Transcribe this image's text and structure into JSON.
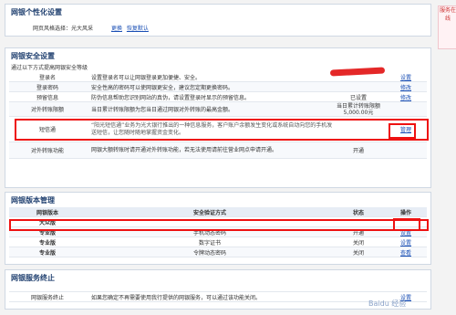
{
  "personalize": {
    "title": "网银个性化设置",
    "style_label": "网页风格选择：光大风采",
    "change_link": "更换",
    "restore_link": "恢复默认"
  },
  "security": {
    "title": "网银安全设置",
    "subtitle": "通过以下方式提高网银安全等级",
    "rows": [
      {
        "name": "登录名",
        "desc": "设置登录名可以让网银登录更加便捷、安全。",
        "status": "",
        "action": "设置"
      },
      {
        "name": "登录密码",
        "desc": "安全性高的密码可以使网银更安全，建议您定期更换密码。",
        "status": "",
        "action": "修改"
      },
      {
        "name": "预留信息",
        "desc": "防伪信息帮助您识别网站的真伪，请设置登录时显示的预留信息。",
        "status": "已设置",
        "action": "修改"
      },
      {
        "name": "对外转账限额",
        "desc": "当日累计转账限额为您当日通过网银对外转账的最高金额。",
        "status": "当日累计转账限额 5,000.00元",
        "action": ""
      },
      {
        "name": "短信通",
        "desc": "“阳光短信通”业务为光大银行推出的一种信息服务，客户账户余额发生变化或系统自动向您的手机发送短信，让您随时随地掌握资金变化。",
        "status": "",
        "action": "管理"
      },
      {
        "name": "对外转账功能",
        "desc": "网银大额转账时请开通对外转账功能，若无法使用请前往营业网点申请开通。",
        "status": "开通",
        "action": ""
      }
    ]
  },
  "edition": {
    "title": "网银版本管理",
    "headers": [
      "网银版本",
      "安全验证方式",
      "状态",
      "操作"
    ],
    "rows": [
      {
        "name": "大众版",
        "method": "",
        "status": "",
        "action": ""
      },
      {
        "name": "专业版",
        "method": "手机动态密码",
        "status": "开通",
        "action": "设置"
      },
      {
        "name": "专业版",
        "method": "数字证书",
        "status": "关闭",
        "action": "设置"
      },
      {
        "name": "专业版",
        "method": "令牌动态密码",
        "status": "关闭",
        "action": "查看"
      }
    ]
  },
  "termination": {
    "title": "网银服务终止",
    "row_name": "网银服务终止",
    "row_desc": "如果您确定不再需要使用我行提供的网银服务，可以通过该功能关闭。",
    "action": "设置"
  },
  "side_tab": "服务在线",
  "watermark": "Baidu 经验"
}
